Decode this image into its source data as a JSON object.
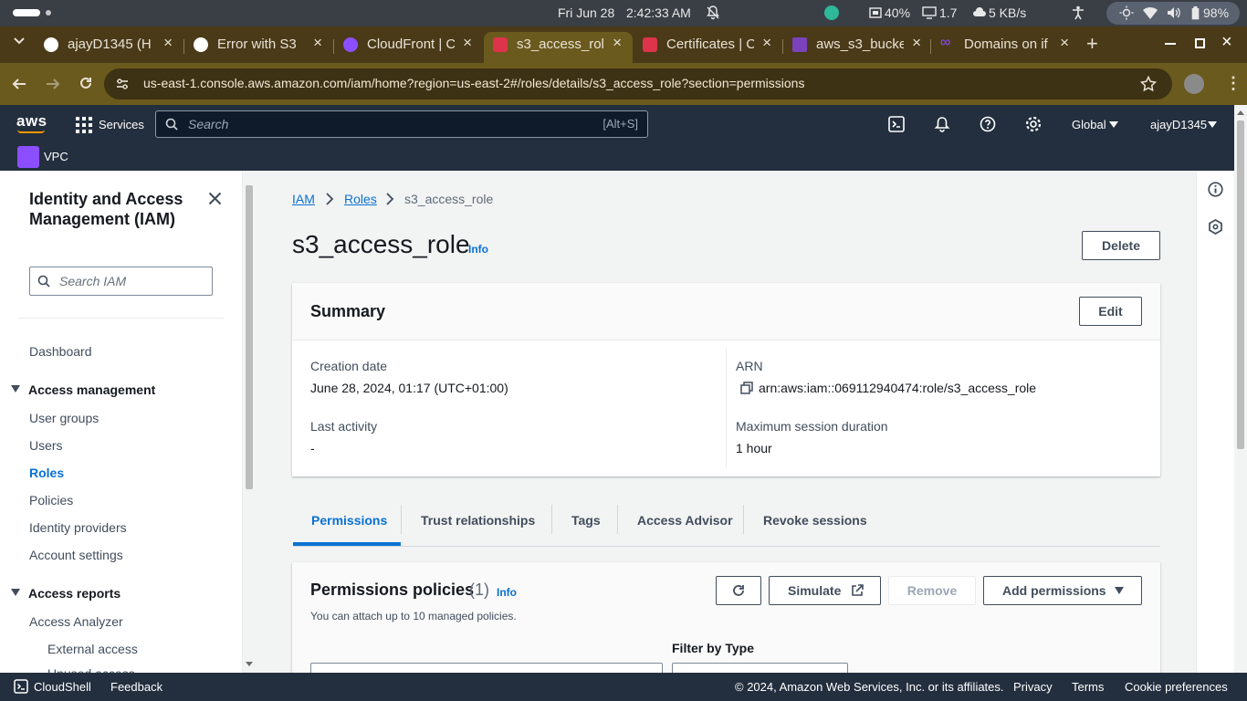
{
  "os": {
    "date": "Fri Jun 28",
    "time": "2:42:33 AM",
    "cpu": "40%",
    "mem": "1.7",
    "net": "5 KB/s",
    "battery": "98%"
  },
  "browser": {
    "tabs": [
      {
        "title": "ajayD1345 (H",
        "icon": "github-icon",
        "color": "#ffffff"
      },
      {
        "title": "Error with S3",
        "icon": "chatgpt-icon",
        "color": "#ffffff"
      },
      {
        "title": "CloudFront | C",
        "icon": "cloudfront-icon",
        "color": "#8c4fff"
      },
      {
        "title": "s3_access_rol",
        "icon": "iam-icon",
        "color": "#dd344c"
      },
      {
        "title": "Certificates | C",
        "icon": "acm-icon",
        "color": "#dd344c"
      },
      {
        "title": "aws_s3_bucke",
        "icon": "terraform-icon",
        "color": "#7b42bc"
      },
      {
        "title": "Domains on if",
        "icon": "infinityfree-icon",
        "color": "#8c4fff"
      }
    ],
    "url": "us-east-1.console.aws.amazon.com/iam/home?region=us-east-2#/roles/details/s3_access_role?section=permissions"
  },
  "aws_nav": {
    "logo": "aws",
    "services_label": "Services",
    "search_placeholder": "Search",
    "search_shortcut": "[Alt+S]",
    "region": "Global",
    "account": "ajayD1345",
    "pinned_service": "VPC"
  },
  "sidebar": {
    "title": "Identity and Access Management (IAM)",
    "search_placeholder": "Search IAM",
    "dashboard": "Dashboard",
    "access_management": "Access management",
    "access_items": [
      "User groups",
      "Users",
      "Roles",
      "Policies",
      "Identity providers",
      "Account settings"
    ],
    "active_item": "Roles",
    "access_reports": "Access reports",
    "report_items": [
      "Access Analyzer",
      "External access",
      "Unused access"
    ]
  },
  "breadcrumb": {
    "items": [
      "IAM",
      "Roles"
    ],
    "current": "s3_access_role"
  },
  "page": {
    "title": "s3_access_role",
    "info": "Info",
    "delete_button": "Delete"
  },
  "summary": {
    "title": "Summary",
    "edit_button": "Edit",
    "creation_date_label": "Creation date",
    "creation_date": "June 28, 2024, 01:17 (UTC+01:00)",
    "arn_label": "ARN",
    "arn": "arn:aws:iam::069112940474:role/s3_access_role",
    "last_activity_label": "Last activity",
    "last_activity": "-",
    "max_session_label": "Maximum session duration",
    "max_session": "1 hour"
  },
  "tabs": {
    "items": [
      "Permissions",
      "Trust relationships",
      "Tags",
      "Access Advisor",
      "Revoke sessions"
    ],
    "active": "Permissions"
  },
  "permissions": {
    "title": "Permissions policies",
    "count": "(1)",
    "info": "Info",
    "subtitle": "You can attach up to 10 managed policies.",
    "simulate_button": "Simulate",
    "remove_button": "Remove",
    "add_button": "Add permissions",
    "filter_label": "Filter by Type"
  },
  "footer": {
    "cloudshell": "CloudShell",
    "feedback": "Feedback",
    "copyright": "© 2024, Amazon Web Services, Inc. or its affiliates.",
    "privacy": "Privacy",
    "terms": "Terms",
    "cookies": "Cookie preferences"
  },
  "colors": {
    "aws_nav": "#232f3e",
    "link": "#0972d3",
    "active_tab_underline": "#0972d3",
    "chrome_frame": "#4a3a18"
  }
}
